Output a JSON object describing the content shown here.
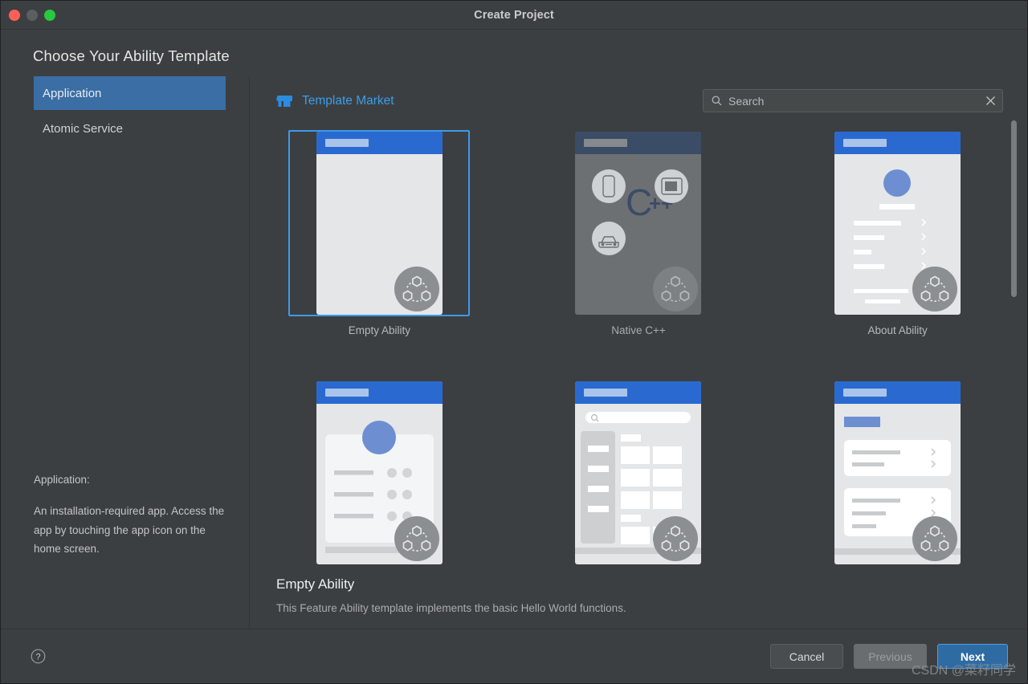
{
  "window": {
    "title": "Create Project",
    "controls": {
      "close": "close-button",
      "minimize": "minimize-button",
      "maximize": "maximize-button"
    }
  },
  "heading": "Choose Your Ability Template",
  "sidebar": {
    "items": [
      {
        "label": "Application",
        "selected": true
      },
      {
        "label": "Atomic Service",
        "selected": false
      }
    ],
    "description": {
      "title": "Application:",
      "text": "An installation-required app. Access the app by touching the app icon on the home screen."
    }
  },
  "market": {
    "label": "Template Market",
    "icon": "store-icon"
  },
  "search": {
    "placeholder": "Search",
    "value": "",
    "icon": "search-icon",
    "clear_icon": "close-icon"
  },
  "templates": [
    {
      "label": "Empty Ability",
      "selected": true,
      "style": "empty"
    },
    {
      "label": "Native C++",
      "selected": false,
      "style": "native"
    },
    {
      "label": "About Ability",
      "selected": false,
      "style": "about"
    },
    {
      "label": "",
      "selected": false,
      "style": "profile"
    },
    {
      "label": "",
      "selected": false,
      "style": "category"
    },
    {
      "label": "",
      "selected": false,
      "style": "settings"
    }
  ],
  "detail": {
    "title": "Empty Ability",
    "description": "This Feature Ability template implements the basic Hello World functions."
  },
  "footer": {
    "help_icon": "help-icon",
    "cancel": "Cancel",
    "previous": "Previous",
    "next": "Next"
  },
  "watermark": "CSDN @菜籽同学",
  "colors": {
    "accent": "#3a6ea5",
    "link": "#3a9eea",
    "selection_border": "#3d9ae8",
    "window_bg": "#3c3f41",
    "primary_button": "#2f6ba3"
  }
}
